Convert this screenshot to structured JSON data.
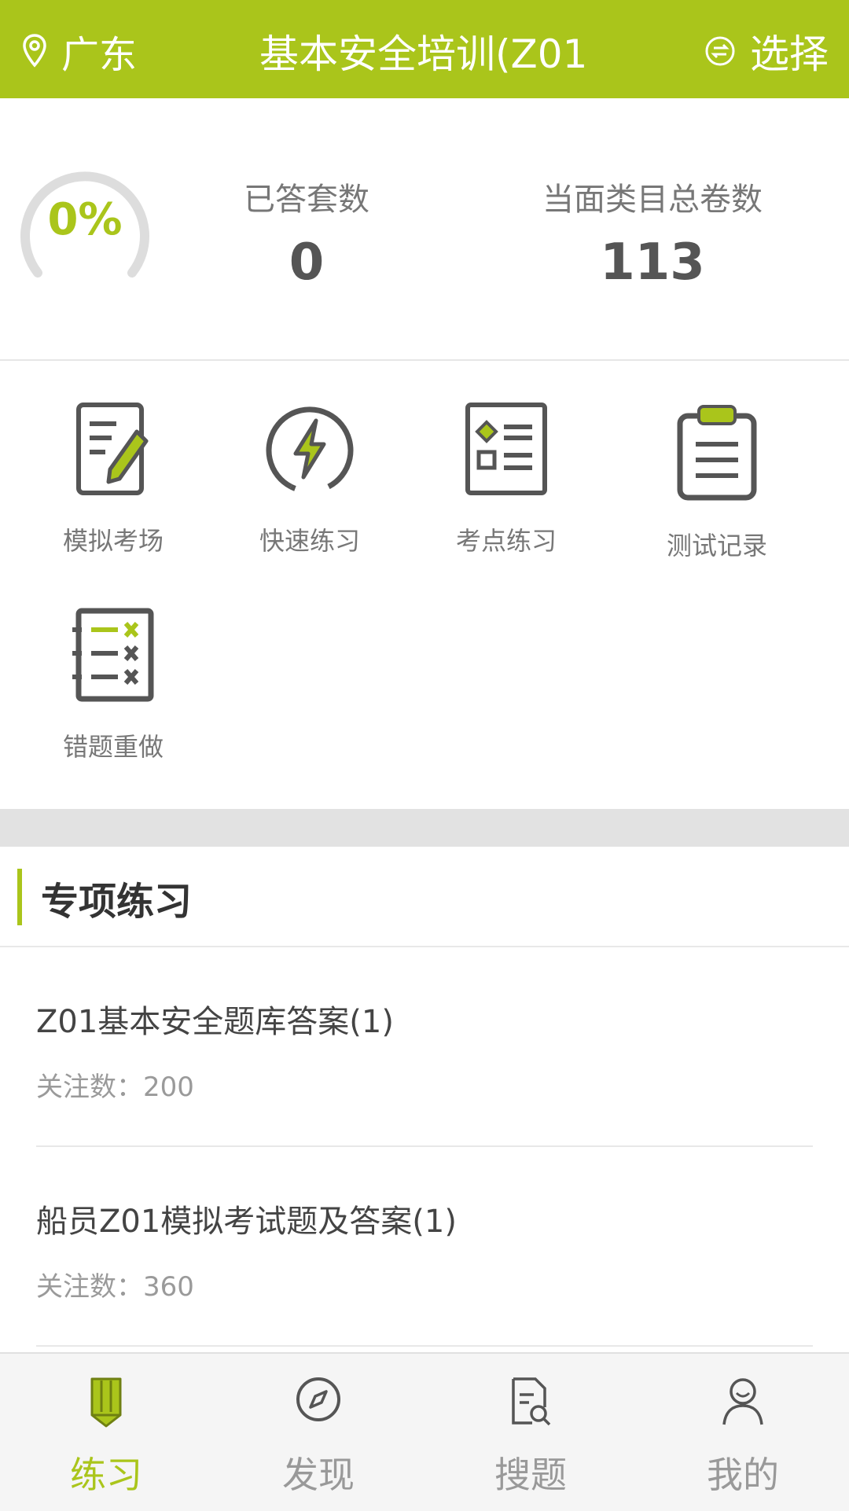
{
  "header": {
    "location": "广东",
    "title": "基本安全培训(Z01",
    "choose_label": "选择",
    "bg_color": "#aac51b"
  },
  "stats": {
    "progress_text": "0%",
    "progress": 0,
    "answered_label": "已答套数",
    "answered_value": "0",
    "total_label": "当面类目总卷数",
    "total_value": "113"
  },
  "features": [
    {
      "label": "模拟考场",
      "icon": "exam-pencil-icon"
    },
    {
      "label": "快速练习",
      "icon": "lightning-icon"
    },
    {
      "label": "考点练习",
      "icon": "checklist-icon"
    },
    {
      "label": "测试记录",
      "icon": "clipboard-icon"
    },
    {
      "label": "错题重做",
      "icon": "wrong-list-icon"
    }
  ],
  "section": {
    "title": "专项练习",
    "items": [
      {
        "name": "Z01基本安全题库答案(1)",
        "follow": "关注数：200"
      },
      {
        "name": "船员Z01模拟考试题及答案(1)",
        "follow": "关注数：360"
      }
    ]
  },
  "nav": {
    "tabs": [
      {
        "label": "练习",
        "icon": "pencil-icon",
        "active": true
      },
      {
        "label": "发现",
        "icon": "compass-icon",
        "active": false
      },
      {
        "label": "搜题",
        "icon": "document-search-icon",
        "active": false
      },
      {
        "label": "我的",
        "icon": "user-icon",
        "active": false
      }
    ]
  },
  "colors": {
    "accent": "#aac51b",
    "icon_dark": "#555555"
  }
}
